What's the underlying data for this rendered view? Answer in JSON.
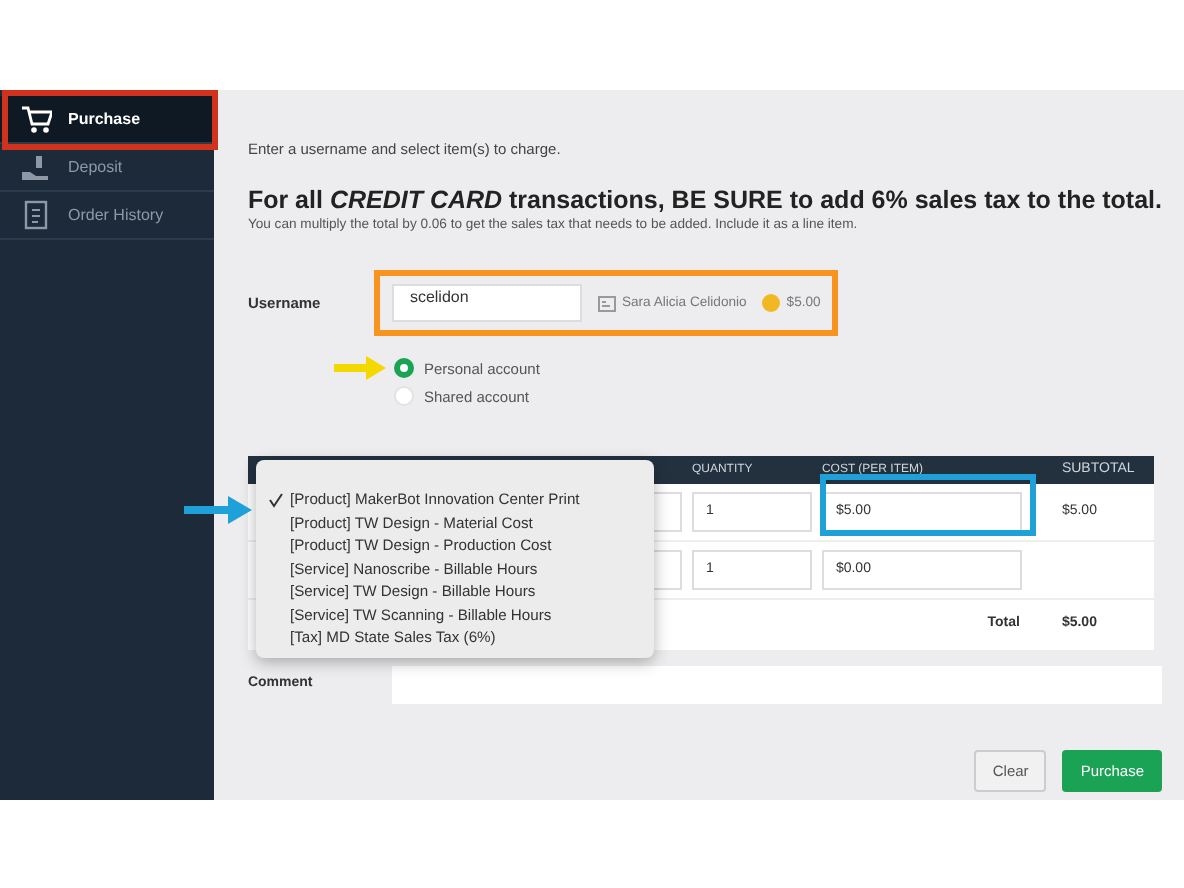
{
  "sidebar": {
    "items": [
      {
        "label": "Purchase",
        "kind": "cart",
        "selected": true
      },
      {
        "label": "Deposit",
        "kind": "deposit",
        "selected": false
      },
      {
        "label": "Order History",
        "kind": "history",
        "selected": false
      }
    ]
  },
  "intro": "Enter a username and select item(s) to charge.",
  "heading": "For all *CREDIT CARD* transactions, BE SURE to add 6% sales tax to the total.",
  "note": "You can multiply the total by 0.06 to get the sales tax that needs to be added. Include it as a line item.",
  "username": {
    "label": "Username",
    "value": "scelidon",
    "full_name": "Sara Alicia Celidonio",
    "balance": "$5.00"
  },
  "account_options": [
    {
      "label": "Personal account",
      "selected": true
    },
    {
      "label": "Shared account",
      "selected": false
    }
  ],
  "table": {
    "columns": [
      "QUANTITY",
      "COST (PER ITEM)",
      "SUBTOTAL"
    ],
    "rows": [
      {
        "quantity": "1",
        "cost": "$5.00",
        "subtotal": "$5.00"
      },
      {
        "quantity": "1",
        "cost": "$0.00"
      }
    ],
    "total_label": "Total",
    "total": "$5.00"
  },
  "item_dropdown": {
    "options": [
      {
        "label": "[Product] MakerBot Innovation Center Print",
        "selected": true
      },
      {
        "label": "[Product] TW Design - Material Cost",
        "selected": false
      },
      {
        "label": "[Product] TW Design - Production Cost",
        "selected": false
      },
      {
        "label": "[Service] Nanoscribe - Billable Hours",
        "selected": false
      },
      {
        "label": "[Service] TW Design - Billable Hours",
        "selected": false
      },
      {
        "label": "[Service] TW Scanning - Billable Hours",
        "selected": false
      },
      {
        "label": "[Tax] MD State Sales Tax (6%)",
        "selected": false
      }
    ]
  },
  "comment": {
    "label": "Comment"
  },
  "buttons": [
    {
      "label": "Clear",
      "kind": "secondary"
    },
    {
      "label": "Purchase",
      "kind": "primary"
    }
  ]
}
